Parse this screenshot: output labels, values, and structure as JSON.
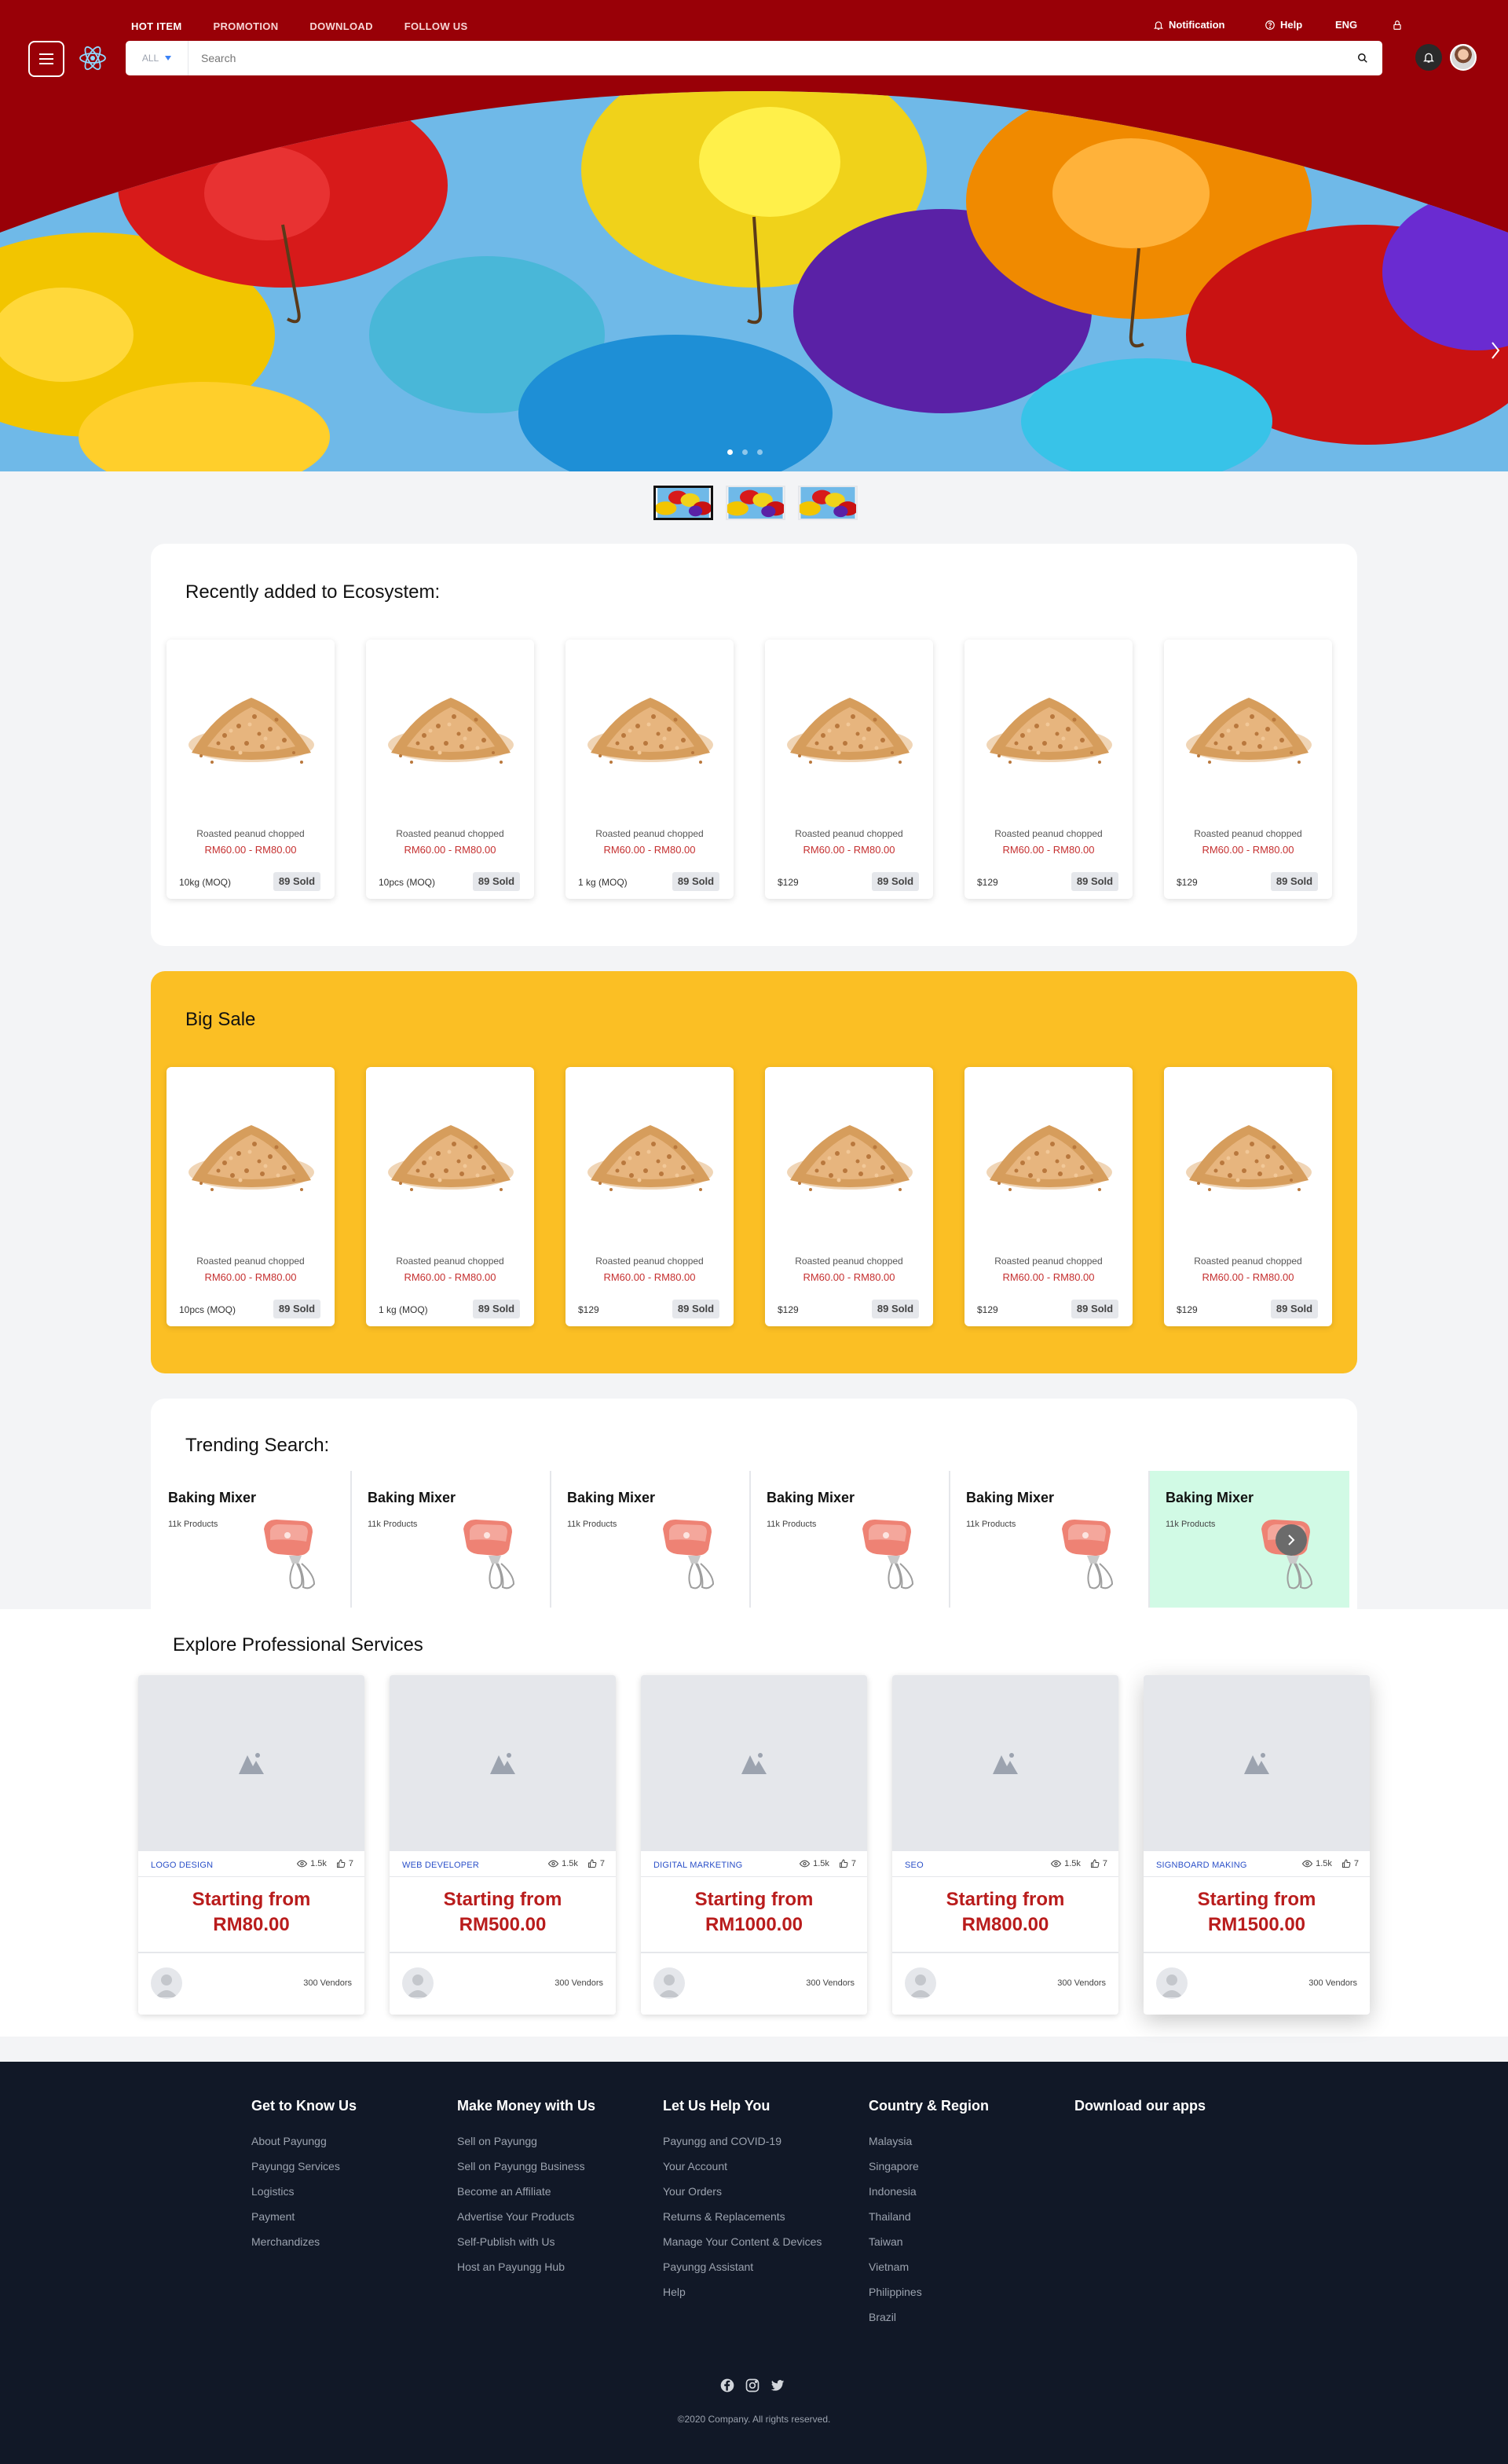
{
  "nav": {
    "top_links": [
      "HOT ITEM",
      "PROMOTION",
      "DOWNLOAD",
      "FOLLOW US"
    ],
    "notification": "Notification",
    "help": "Help",
    "language": "ENG"
  },
  "search": {
    "category": "ALL",
    "placeholder": "Search"
  },
  "recent": {
    "title": "Recently added to Ecosystem:",
    "products": [
      {
        "name": "Roasted peanud chopped",
        "price": "RM60.00 - RM80.00",
        "moq": "10kg (MOQ)",
        "sold": "89 Sold"
      },
      {
        "name": "Roasted peanud chopped",
        "price": "RM60.00 - RM80.00",
        "moq": "10pcs (MOQ)",
        "sold": "89 Sold"
      },
      {
        "name": "Roasted peanud chopped",
        "price": "RM60.00 - RM80.00",
        "moq": "1 kg (MOQ)",
        "sold": "89 Sold"
      },
      {
        "name": "Roasted peanud chopped",
        "price": "RM60.00 - RM80.00",
        "moq": "$129",
        "sold": "89 Sold"
      },
      {
        "name": "Roasted peanud chopped",
        "price": "RM60.00 - RM80.00",
        "moq": "$129",
        "sold": "89 Sold"
      },
      {
        "name": "Roasted peanud chopped",
        "price": "RM60.00 - RM80.00",
        "moq": "$129",
        "sold": "89 Sold"
      }
    ]
  },
  "bigsale": {
    "title": "Big Sale",
    "products": [
      {
        "name": "Roasted peanud chopped",
        "price": "RM60.00 - RM80.00",
        "moq": "10pcs (MOQ)",
        "sold": "89 Sold"
      },
      {
        "name": "Roasted peanud chopped",
        "price": "RM60.00 - RM80.00",
        "moq": "1 kg (MOQ)",
        "sold": "89 Sold"
      },
      {
        "name": "Roasted peanud chopped",
        "price": "RM60.00 - RM80.00",
        "moq": "$129",
        "sold": "89 Sold"
      },
      {
        "name": "Roasted peanud chopped",
        "price": "RM60.00 - RM80.00",
        "moq": "$129",
        "sold": "89 Sold"
      },
      {
        "name": "Roasted peanud chopped",
        "price": "RM60.00 - RM80.00",
        "moq": "$129",
        "sold": "89 Sold"
      },
      {
        "name": "Roasted peanud chopped",
        "price": "RM60.00 - RM80.00",
        "moq": "$129",
        "sold": "89 Sold"
      }
    ]
  },
  "trending": {
    "title": "Trending Search:",
    "items": [
      {
        "name": "Baking Mixer",
        "count": "11k Products"
      },
      {
        "name": "Baking Mixer",
        "count": "11k Products"
      },
      {
        "name": "Baking Mixer",
        "count": "11k Products"
      },
      {
        "name": "Baking Mixer",
        "count": "11k Products"
      },
      {
        "name": "Baking Mixer",
        "count": "11k Products"
      },
      {
        "name": "Baking Mixer",
        "count": "11k Products"
      }
    ]
  },
  "services": {
    "title": "Explore Professional Services",
    "items": [
      {
        "category": "LOGO DESIGN",
        "views": "1.5k",
        "likes": "7",
        "from": "Starting from",
        "price": "RM80.00",
        "vendors": "300 Vendors"
      },
      {
        "category": "WEB DEVELOPER",
        "views": "1.5k",
        "likes": "7",
        "from": "Starting from",
        "price": "RM500.00",
        "vendors": "300 Vendors"
      },
      {
        "category": "DIGITAL MARKETING",
        "views": "1.5k",
        "likes": "7",
        "from": "Starting from",
        "price": "RM1000.00",
        "vendors": "300 Vendors"
      },
      {
        "category": "SEO",
        "views": "1.5k",
        "likes": "7",
        "from": "Starting from",
        "price": "RM800.00",
        "vendors": "300 Vendors"
      },
      {
        "category": "SIGNBOARD MAKING",
        "views": "1.5k",
        "likes": "7",
        "from": "Starting from",
        "price": "RM1500.00",
        "vendors": "300 Vendors"
      }
    ]
  },
  "footer": {
    "columns": [
      {
        "title": "Get to Know Us",
        "items": [
          "About Payungg",
          "Payungg Services",
          "Logistics",
          "Payment",
          "Merchandizes"
        ]
      },
      {
        "title": "Make Money with Us",
        "items": [
          "Sell on Payungg",
          "Sell on Payungg Business",
          "Become an Affiliate",
          "Advertise Your Products",
          "Self-Publish with Us",
          "Host an Payungg Hub"
        ]
      },
      {
        "title": "Let Us Help You",
        "items": [
          "Payungg and COVID-19",
          "Your Account",
          "Your Orders",
          "Returns & Replacements",
          "Manage Your Content & Devices",
          "Payungg Assistant",
          "Help"
        ]
      },
      {
        "title": "Country & Region",
        "items": [
          "Malaysia",
          "Singapore",
          "Indonesia",
          "Thailand",
          "Taiwan",
          "Vietnam",
          "Philippines",
          "Brazil"
        ]
      },
      {
        "title": "Download our apps",
        "items": []
      }
    ],
    "copyright": "©2020 Company. All rights reserved."
  },
  "colors": {
    "brand_red": "#990007",
    "big_sale_yellow": "#fbbf24",
    "price_red": "#c53030",
    "footer_bg": "#111827",
    "trend_highlight": "#d1fae5"
  }
}
